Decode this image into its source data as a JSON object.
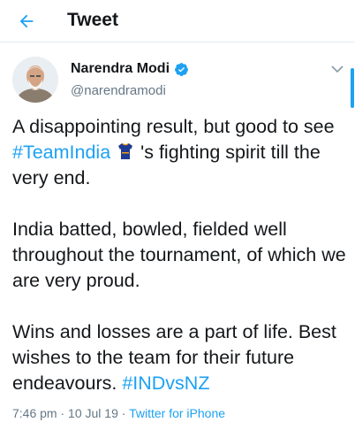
{
  "header": {
    "title": "Tweet"
  },
  "author": {
    "name": "Narendra Modi",
    "handle": "@narendramodi",
    "verified": true
  },
  "tweet": {
    "p1_a": "A disappointing result, but good to see ",
    "p1_tag": "#TeamIndia",
    "p1_b": " 's fighting spirit till the very end.",
    "p2": "India batted, bowled, fielded well throughout the tournament, of which we are very proud.",
    "p3_a": "Wins and losses are a part of life. Best wishes to the team for their future endeavours. ",
    "p3_tag": "#INDvsNZ"
  },
  "meta": {
    "time": "7:46 pm",
    "sep1": " · ",
    "date": "10 Jul 19",
    "sep2": " · ",
    "source": "Twitter for iPhone"
  },
  "colors": {
    "accent": "#1da1f2",
    "text": "#14171a",
    "muted": "#657786"
  }
}
